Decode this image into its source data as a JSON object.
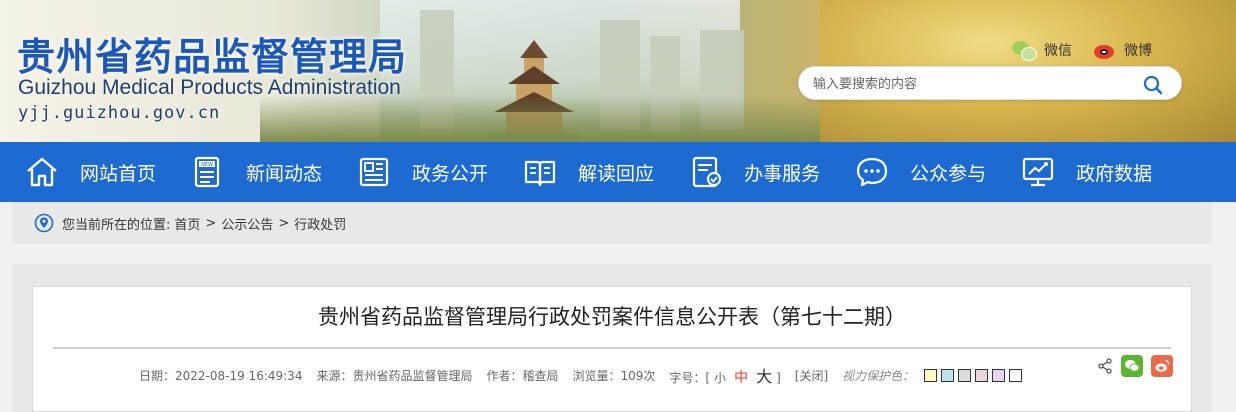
{
  "header": {
    "title_cn": "贵州省药品监督管理局",
    "title_en": "Guizhou Medical Products Administration",
    "domain": "yjj.guizhou.gov.cn",
    "social": [
      {
        "label": "微信",
        "icon": "wechat-icon"
      },
      {
        "label": "微博",
        "icon": "weibo-icon"
      }
    ],
    "search": {
      "placeholder": "输入要搜索的内容",
      "icon": "search-icon"
    }
  },
  "nav": {
    "items": [
      {
        "label": "网站首页",
        "icon": "home-icon"
      },
      {
        "label": "新闻动态",
        "icon": "news-icon"
      },
      {
        "label": "政务公开",
        "icon": "document-icon"
      },
      {
        "label": "解读回应",
        "icon": "book-icon"
      },
      {
        "label": "办事服务",
        "icon": "service-icon"
      },
      {
        "label": "公众参与",
        "icon": "chat-icon"
      },
      {
        "label": "政府数据",
        "icon": "data-screen-icon"
      }
    ],
    "background": "#1d6ad0"
  },
  "breadcrumb": {
    "prefix": "您当前所在的位置:",
    "items": [
      "首页",
      "公示公告",
      "行政处罚"
    ],
    "separator": ">"
  },
  "article": {
    "title": "贵州省药品监督管理局行政处罚案件信息公开表（第七十二期）",
    "date": "日期：2022-08-19 16:49:34",
    "source": "来源：贵州省药品监督管理局",
    "author": "作者：稽查局",
    "views": "浏览量：109次",
    "font_size_label": "字号：[",
    "font_small": "小",
    "font_medium": "中",
    "font_large": "大",
    "font_close_bracket": "]",
    "close_label": "[关闭]",
    "protect_label": "视力保护色：",
    "swatch_colors": [
      "#fef9c3",
      "#bfe3ee",
      "#dcdcdc",
      "#e9d5da",
      "#e9d5f2",
      "#ffffff"
    ]
  },
  "share": {
    "icons": [
      "share-icon",
      "wechat-share-icon",
      "weibo-share-icon"
    ]
  }
}
